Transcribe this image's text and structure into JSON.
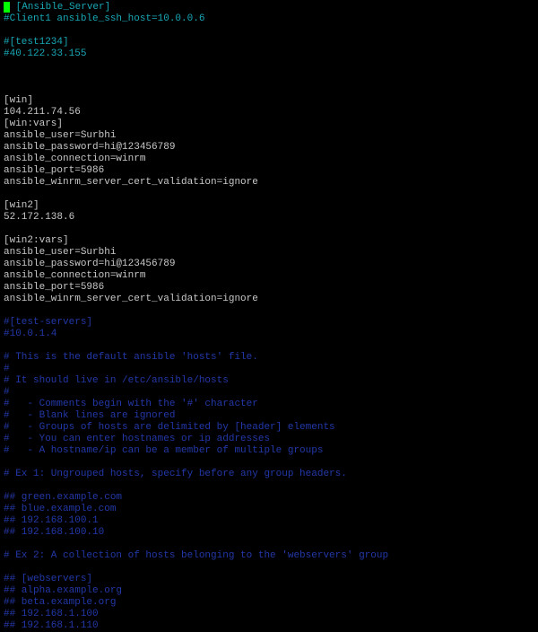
{
  "lines": [
    {
      "cls": "cyan",
      "text": " [Ansible_Server]",
      "cursor": true
    },
    {
      "cls": "cyan",
      "text": "#Client1 ansible_ssh_host=10.0.0.6"
    },
    {
      "cls": "blank",
      "text": ""
    },
    {
      "cls": "cyan",
      "text": "#[test1234]"
    },
    {
      "cls": "cyan",
      "text": "#40.122.33.155"
    },
    {
      "cls": "blank",
      "text": ""
    },
    {
      "cls": "blank",
      "text": ""
    },
    {
      "cls": "blank",
      "text": ""
    },
    {
      "cls": "white",
      "text": "[win]"
    },
    {
      "cls": "white",
      "text": "104.211.74.56"
    },
    {
      "cls": "white",
      "text": "[win:vars]"
    },
    {
      "cls": "white",
      "text": "ansible_user=Surbhi"
    },
    {
      "cls": "white",
      "text": "ansible_password=hi@123456789"
    },
    {
      "cls": "white",
      "text": "ansible_connection=winrm"
    },
    {
      "cls": "white",
      "text": "ansible_port=5986"
    },
    {
      "cls": "white",
      "text": "ansible_winrm_server_cert_validation=ignore"
    },
    {
      "cls": "blank",
      "text": ""
    },
    {
      "cls": "white",
      "text": "[win2]"
    },
    {
      "cls": "white",
      "text": "52.172.138.6"
    },
    {
      "cls": "blank",
      "text": ""
    },
    {
      "cls": "white",
      "text": "[win2:vars]"
    },
    {
      "cls": "white",
      "text": "ansible_user=Surbhi"
    },
    {
      "cls": "white",
      "text": "ansible_password=hi@123456789"
    },
    {
      "cls": "white",
      "text": "ansible_connection=winrm"
    },
    {
      "cls": "white",
      "text": "ansible_port=5986"
    },
    {
      "cls": "white",
      "text": "ansible_winrm_server_cert_validation=ignore"
    },
    {
      "cls": "blank",
      "text": ""
    },
    {
      "cls": "blue",
      "text": "#[test-servers]"
    },
    {
      "cls": "blue",
      "text": "#10.0.1.4"
    },
    {
      "cls": "blank",
      "text": ""
    },
    {
      "cls": "blue",
      "text": "# This is the default ansible 'hosts' file."
    },
    {
      "cls": "blue",
      "text": "#"
    },
    {
      "cls": "blue",
      "text": "# It should live in /etc/ansible/hosts"
    },
    {
      "cls": "blue",
      "text": "#"
    },
    {
      "cls": "blue",
      "text": "#   - Comments begin with the '#' character"
    },
    {
      "cls": "blue",
      "text": "#   - Blank lines are ignored"
    },
    {
      "cls": "blue",
      "text": "#   - Groups of hosts are delimited by [header] elements"
    },
    {
      "cls": "blue",
      "text": "#   - You can enter hostnames or ip addresses"
    },
    {
      "cls": "blue",
      "text": "#   - A hostname/ip can be a member of multiple groups"
    },
    {
      "cls": "blank",
      "text": ""
    },
    {
      "cls": "blue",
      "text": "# Ex 1: Ungrouped hosts, specify before any group headers."
    },
    {
      "cls": "blank",
      "text": ""
    },
    {
      "cls": "blue",
      "text": "## green.example.com"
    },
    {
      "cls": "blue",
      "text": "## blue.example.com"
    },
    {
      "cls": "blue",
      "text": "## 192.168.100.1"
    },
    {
      "cls": "blue",
      "text": "## 192.168.100.10"
    },
    {
      "cls": "blank",
      "text": ""
    },
    {
      "cls": "blue",
      "text": "# Ex 2: A collection of hosts belonging to the 'webservers' group"
    },
    {
      "cls": "blank",
      "text": ""
    },
    {
      "cls": "blue",
      "text": "## [webservers]"
    },
    {
      "cls": "blue",
      "text": "## alpha.example.org"
    },
    {
      "cls": "blue",
      "text": "## beta.example.org"
    },
    {
      "cls": "blue",
      "text": "## 192.168.1.100"
    },
    {
      "cls": "blue",
      "text": "## 192.168.1.110"
    }
  ]
}
